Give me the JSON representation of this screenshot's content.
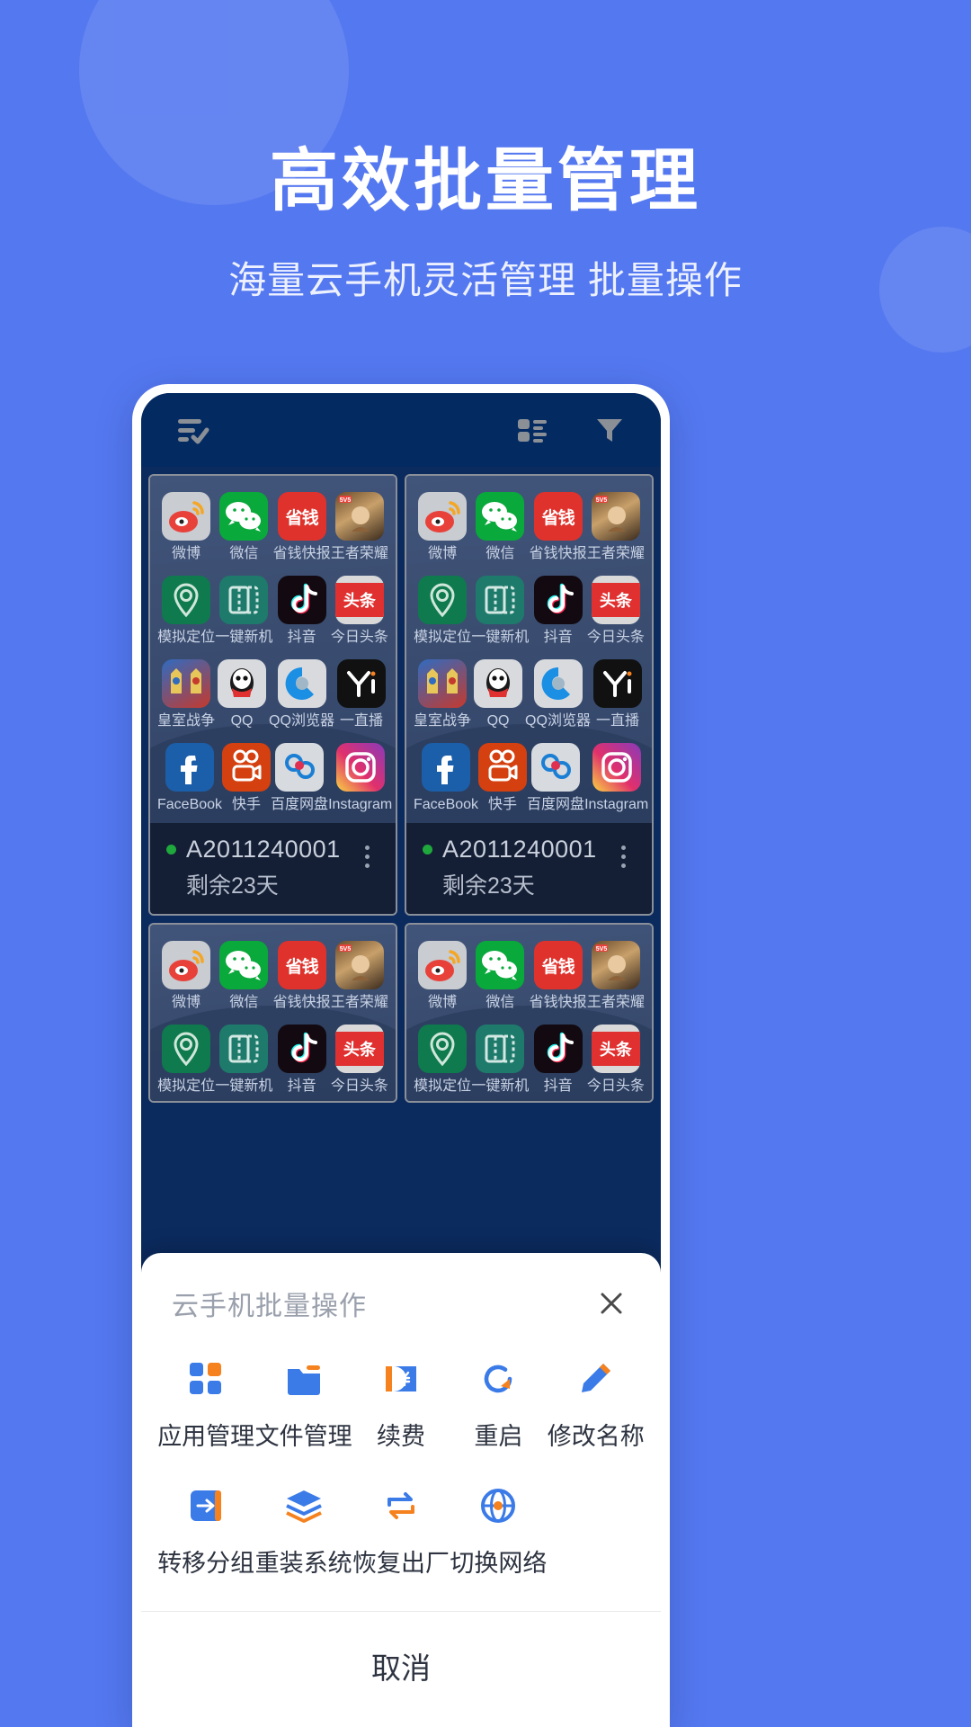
{
  "theme": {
    "background": "#5478F0",
    "accent_blue": "#2F7FE8",
    "accent_orange": "#F5821F",
    "panel_navy": "#042A62",
    "card_navy": "#141F36"
  },
  "hero": {
    "title": "高效批量管理",
    "subtitle": "海量云手机灵活管理 批量操作"
  },
  "app_topbar": {
    "icons": [
      {
        "name": "checklist-icon",
        "label": "批量选择"
      },
      {
        "name": "list-view-icon",
        "label": "列表视图"
      },
      {
        "name": "filter-icon",
        "label": "筛选"
      }
    ]
  },
  "apps": [
    {
      "label": "微博",
      "icon": "weibo-icon"
    },
    {
      "label": "微信",
      "icon": "wechat-icon"
    },
    {
      "label": "省钱快报",
      "icon": "shengqian-icon"
    },
    {
      "label": "王者荣耀",
      "icon": "honor-of-kings-icon"
    },
    {
      "label": "模拟定位",
      "icon": "location-pin-icon"
    },
    {
      "label": "一键新机",
      "icon": "new-device-icon"
    },
    {
      "label": "抖音",
      "icon": "tiktok-icon"
    },
    {
      "label": "今日头条",
      "icon": "toutiao-icon"
    },
    {
      "label": "皇室战争",
      "icon": "clash-royale-icon"
    },
    {
      "label": "QQ",
      "icon": "qq-icon"
    },
    {
      "label": "QQ浏览器",
      "icon": "qq-browser-icon"
    },
    {
      "label": "一直播",
      "icon": "yizhibo-icon"
    },
    {
      "label": "FaceBook",
      "icon": "facebook-icon"
    },
    {
      "label": "快手",
      "icon": "kuaishou-icon"
    },
    {
      "label": "百度网盘",
      "icon": "baidu-netdisk-icon"
    },
    {
      "label": "Instagram",
      "icon": "instagram-icon"
    }
  ],
  "devices": [
    {
      "name": "A2011240001",
      "remaining": "剩余23天",
      "status": "online"
    },
    {
      "name": "A2011240001",
      "remaining": "剩余23天",
      "status": "online"
    }
  ],
  "sheet": {
    "title": "云手机批量操作",
    "close_icon": "close-icon",
    "actions_row1": [
      {
        "label": "应用管理",
        "icon": "grid-apps-icon"
      },
      {
        "label": "文件管理",
        "icon": "folder-icon"
      },
      {
        "label": "续费",
        "icon": "renew-ticket-icon"
      },
      {
        "label": "重启",
        "icon": "restart-icon"
      },
      {
        "label": "修改名称",
        "icon": "pencil-icon"
      }
    ],
    "actions_row2": [
      {
        "label": "转移分组",
        "icon": "transfer-group-icon"
      },
      {
        "label": "重装系统",
        "icon": "layers-icon"
      },
      {
        "label": "恢复出厂",
        "icon": "factory-reset-icon"
      },
      {
        "label": "切换网络",
        "icon": "network-switch-icon"
      }
    ],
    "cancel_label": "取消"
  }
}
